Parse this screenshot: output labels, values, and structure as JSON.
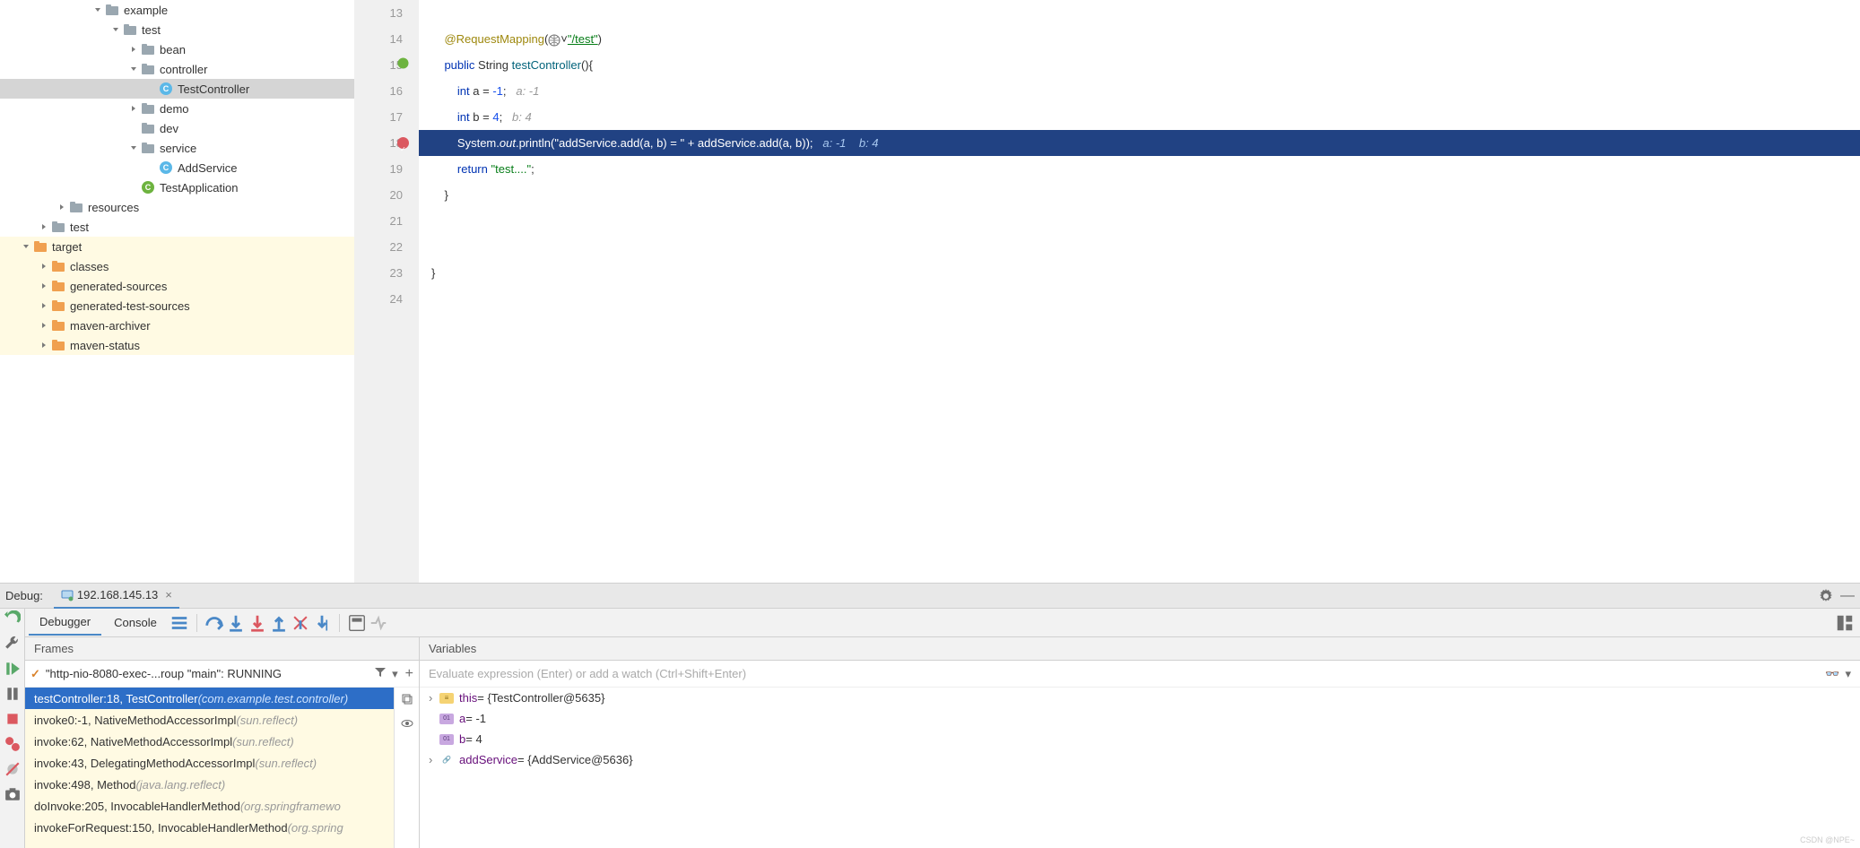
{
  "tree": {
    "example": "example",
    "test": "test",
    "bean": "bean",
    "controller": "controller",
    "testController": "TestController",
    "demo": "demo",
    "dev": "dev",
    "service": "service",
    "addService": "AddService",
    "testApplication": "TestApplication",
    "resources": "resources",
    "test2": "test",
    "target": "target",
    "classes": "classes",
    "genSources": "generated-sources",
    "genTestSources": "generated-test-sources",
    "mavenArchiver": "maven-archiver",
    "mavenStatus": "maven-status"
  },
  "editor": {
    "lines": [
      "13",
      "14",
      "15",
      "16",
      "17",
      "18",
      "19",
      "20",
      "21",
      "22",
      "23",
      "24"
    ],
    "l14_ann": "@RequestMapping",
    "l14_str": "\"/test\"",
    "l15_kw1": "public",
    "l15_type": "String",
    "l15_fn": "testController",
    "l16_kw": "int",
    "l16_var": "a",
    "l16_val": "-1",
    "l16_hint": "a: -1",
    "l17_kw": "int",
    "l17_var": "b",
    "l17_val": "4",
    "l17_hint": "b: 4",
    "l18_sys": "System",
    "l18_out": "out",
    "l18_prn": "println",
    "l18_str": "\"addService.add(a, b) = \"",
    "l18_plus": " + ",
    "l18_call": "addService.add(a, b));",
    "l18_hint_a": "a: -1",
    "l18_hint_b": "b: 4",
    "l19_kw": "return",
    "l19_str": "\"test....\"",
    "l20": "}",
    "l23": "}"
  },
  "debug": {
    "title": "Debug:",
    "config": "192.168.145.13",
    "tabs": {
      "debugger": "Debugger",
      "console": "Console"
    },
    "framesTitle": "Frames",
    "varsTitle": "Variables",
    "thread": "\"http-nio-8080-exec-...roup \"main\": RUNNING",
    "frames": [
      {
        "main": "testController:18, TestController ",
        "pkg": "(com.example.test.controller)",
        "sel": true
      },
      {
        "main": "invoke0:-1, NativeMethodAccessorImpl ",
        "pkg": "(sun.reflect)"
      },
      {
        "main": "invoke:62, NativeMethodAccessorImpl ",
        "pkg": "(sun.reflect)"
      },
      {
        "main": "invoke:43, DelegatingMethodAccessorImpl ",
        "pkg": "(sun.reflect)"
      },
      {
        "main": "invoke:498, Method ",
        "pkg": "(java.lang.reflect)"
      },
      {
        "main": "doInvoke:205, InvocableHandlerMethod ",
        "pkg": "(org.springframewo"
      },
      {
        "main": "invokeForRequest:150, InvocableHandlerMethod ",
        "pkg": "(org.spring"
      }
    ],
    "evalPlaceholder": "Evaluate expression (Enter) or add a watch (Ctrl+Shift+Enter)",
    "vars": {
      "this_name": "this",
      "this_val": " = {TestController@5635}",
      "a_name": "a",
      "a_val": " = -1",
      "b_name": "b",
      "b_val": " = 4",
      "svc_name": "addService",
      "svc_val": " = {AddService@5636}"
    }
  },
  "watermark": "CSDN @NPE~"
}
